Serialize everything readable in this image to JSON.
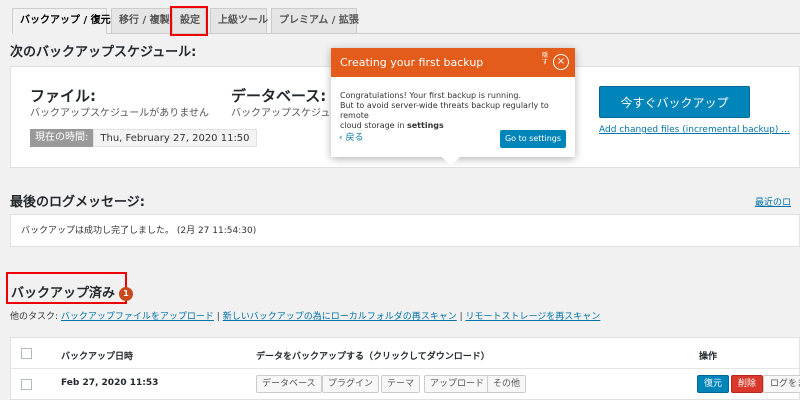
{
  "tabs": [
    {
      "label": "バックアップ / 復元"
    },
    {
      "label": "移行 / 複製"
    },
    {
      "label": "設定"
    },
    {
      "label": "上級ツール"
    },
    {
      "label": "プレミアム / 拡張"
    }
  ],
  "schedule": {
    "title": "次のバックアップスケジュール:",
    "files_label": "ファイル:",
    "files_status": "バックアップスケジュールがありません",
    "db_label": "データベース:",
    "db_status": "バックアップスケジュ",
    "current_time_label": "現在の時間:",
    "current_time_value": "Thu, February 27, 2020 11:50",
    "backup_now_button": "今すぐバックアップ",
    "add_changed_link": "Add changed files (incremental backup) ..."
  },
  "popover": {
    "title": "Creating your first backup",
    "hide_label": "隠す",
    "line1": "Congratulations! Your first backup is running.",
    "line2": "But to avoid server-wide threats backup regularly to remote",
    "line3_pre": "cloud storage in ",
    "line3_bold": "settings",
    "back_link": "‹ 戻る",
    "go_button": "Go to settings"
  },
  "log": {
    "title": "最後のログメッセージ:",
    "recent_link": "最近のロ",
    "message": "バックアップは成功し完了しました。 (2月 27 11:54:30)"
  },
  "backups": {
    "title": "バックアップ済み",
    "count": "1",
    "other_tasks_label": "他のタスク:",
    "task1": "バックアップファイルをアップロード",
    "sep": " | ",
    "task2": "新しいバックアップの為にローカルフォルダの再スキャン",
    "task3": "リモートストレージを再スキャン",
    "headers": {
      "date": "バックアップ日時",
      "data": "データをバックアップする（クリックしてダウンロード）",
      "actions": "操作"
    },
    "rows": [
      {
        "date": "Feb 27, 2020 11:53",
        "items": [
          "データベース",
          "プラグイン",
          "テーマ",
          "アップロード",
          "その他"
        ],
        "restore": "復元",
        "delete": "削除",
        "log": "ログをま"
      }
    ]
  },
  "colors": {
    "accent": "#0085ba",
    "popover_header": "#e45c1b",
    "delete": "#d9382a",
    "highlight": "#ee0000"
  }
}
